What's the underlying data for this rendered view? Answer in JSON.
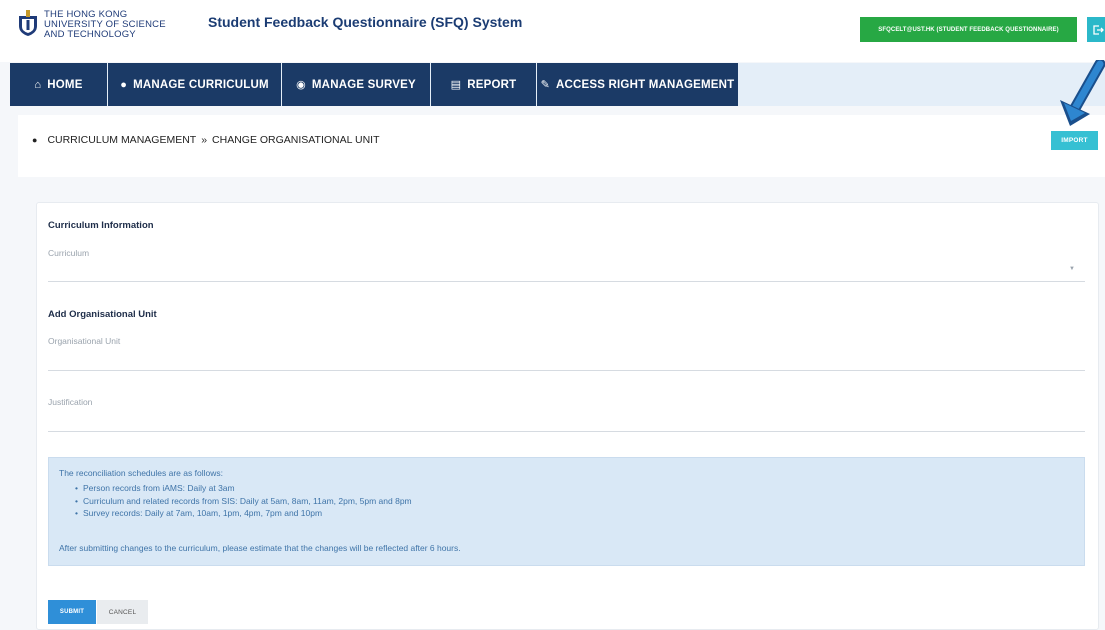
{
  "header": {
    "logo_lines": [
      "THE HONG KONG",
      "UNIVERSITY OF SCIENCE",
      "AND TECHNOLOGY"
    ],
    "app_title": "Student Feedback Questionnaire (SFQ) System",
    "user_badge": "SFQCELT@UST.HK (STUDENT FEEDBACK QUESTIONNAIRE)",
    "logout_icon": "logout-icon"
  },
  "nav": {
    "items": [
      {
        "label": "HOME",
        "icon": "home-icon"
      },
      {
        "label": "MANAGE CURRICULUM",
        "icon": "comment-icon"
      },
      {
        "label": "MANAGE SURVEY",
        "icon": "shield-icon"
      },
      {
        "label": "REPORT",
        "icon": "report-icon"
      },
      {
        "label": "ACCESS RIGHT MANAGEMENT",
        "icon": "pencil-icon"
      }
    ]
  },
  "breadcrumb": {
    "parent": "CURRICULUM MANAGEMENT",
    "separator": "»",
    "current": "CHANGE ORGANISATIONAL UNIT",
    "icon": "comment-icon"
  },
  "toolbar": {
    "import_label": "IMPORT"
  },
  "form": {
    "curriculum_section": "Curriculum Information",
    "curriculum_label": "Curriculum",
    "org_section": "Add Organisational Unit",
    "org_label": "Organisational Unit",
    "justification_label": "Justification"
  },
  "info": {
    "intro": "The reconciliation schedules are as follows:",
    "items": [
      "Person records from iAMS: Daily at 3am",
      "Curriculum and related records from SIS: Daily at 5am, 8am, 11am, 2pm, 5pm and 8pm",
      "Survey records: Daily at 7am, 10am, 1pm, 4pm, 7pm and 10pm"
    ],
    "note": "After submitting changes to the curriculum, please estimate that the changes will be reflected after 6 hours."
  },
  "actions": {
    "submit_label": "SUBMIT",
    "cancel_label": "CANCEL"
  },
  "colors": {
    "nav_bg": "#1b3a66",
    "badge_green": "#27a844",
    "accent_cyan": "#36c0d3",
    "submit_blue": "#2f8fd8",
    "info_bg": "#d9e8f6"
  }
}
